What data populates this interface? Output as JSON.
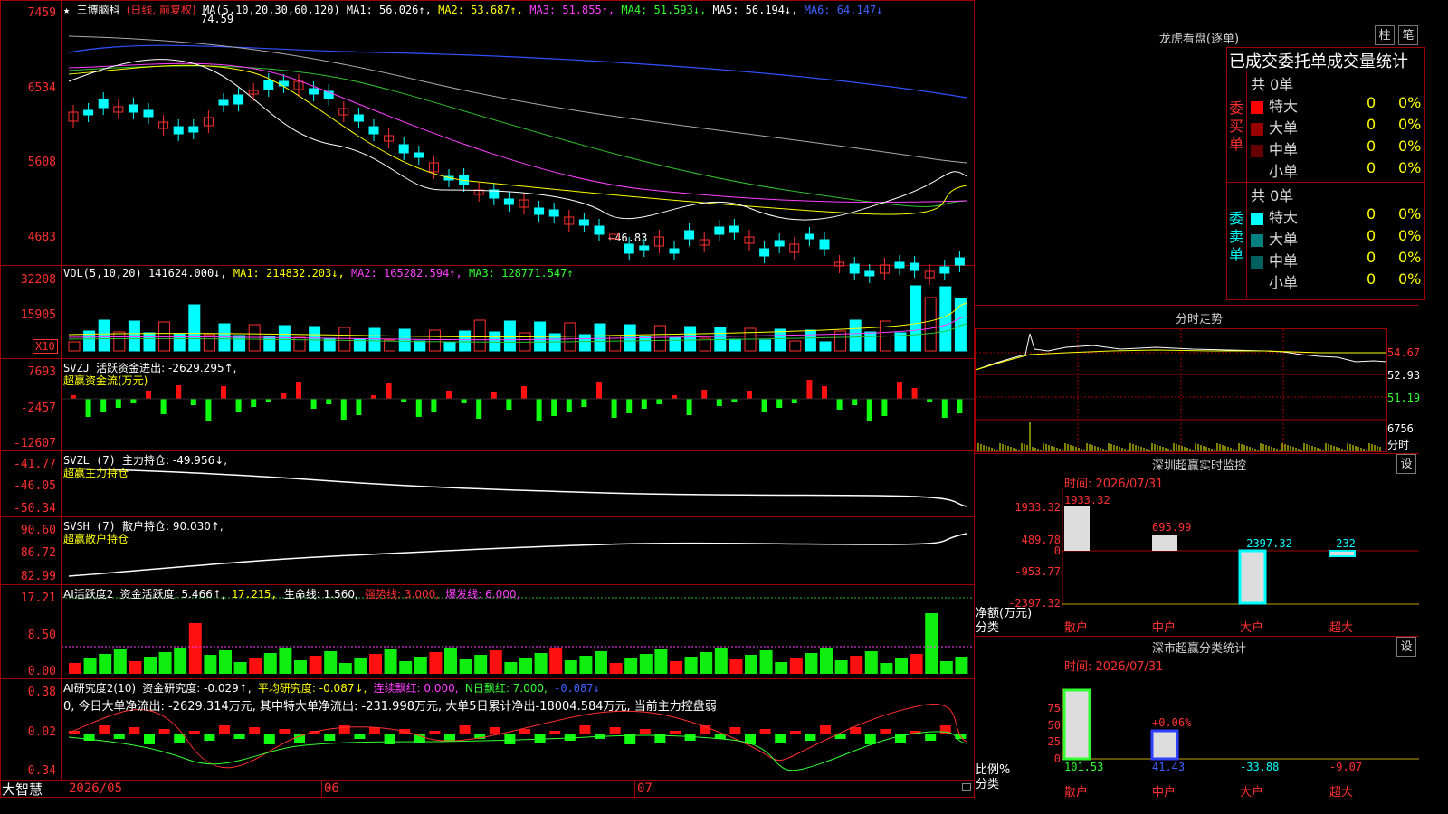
{
  "stock": {
    "name": "三博脑科",
    "period": "(日线, 前复权)",
    "star": "★"
  },
  "main": {
    "ma_label": "MA(5,10,20,30,60,120)",
    "ma1": "MA1: 56.026↑,",
    "ma2": "MA2: 53.687↑,",
    "ma3": "MA3: 51.855↑,",
    "ma4": "MA4: 51.593↓,",
    "ma5": "MA5: 56.194↓,",
    "ma6": "MA6: 64.147↓",
    "y_ticks": [
      "7459",
      "6534",
      "5608",
      "4683"
    ],
    "high_note": "74.59",
    "low_note": "←46.83",
    "price_range": [
      4683,
      7459
    ]
  },
  "vol": {
    "label": "VOL(5,10,20)",
    "value": "141624.000↓,",
    "ma1": "MA1: 214832.203↓,",
    "ma2": "MA2: 165282.594↑,",
    "ma3": "MA3: 128771.547↑",
    "y_ticks": [
      "32208",
      "15905"
    ],
    "unit": "X10"
  },
  "svzj": {
    "label": "SVZJ",
    "text": "活跃资金进出: -2629.295↑,",
    "sub": "超赢资金流(万元)",
    "y_ticks": [
      "7693",
      "-2457",
      "-12607"
    ]
  },
  "svzl": {
    "label": "SVZL (7)",
    "text": "主力持仓: -49.956↓,",
    "sub": "超赢主力持仓",
    "y_ticks": [
      "-41.77",
      "-46.05",
      "-50.34"
    ]
  },
  "svsh": {
    "label": "SVSH (7)",
    "text": "散户持仓: 90.030↑,",
    "sub": "超赢散户持仓",
    "y_ticks": [
      "90.60",
      "86.72",
      "82.99"
    ]
  },
  "ai1": {
    "label": "AI活跃度2",
    "a": "资金活跃度: 5.466↑,",
    "b": "17.215,",
    "c": "生命线: 1.560,",
    "d": "强势线: 3.000,",
    "e": "爆发线: 6.000,",
    "y_ticks": [
      "17.21",
      "8.50",
      "0.00"
    ]
  },
  "ai2": {
    "label": "AI研究度2(10)",
    "a": "资金研究度: -0.029↑,",
    "b": "平均研究度: -0.087↓,",
    "c": "连续飘红: 0.000,",
    "d": "N日飘红: 7.000,",
    "e": "-0.087↓",
    "note": "0, 今日大单净流出: -2629.314万元, 其中特大单净流出: -231.998万元, 大单5日累计净出-18004.584万元, 当前主力控盘弱",
    "y_ticks": [
      "0.38",
      "0.02",
      "-0.34"
    ]
  },
  "bottom": {
    "brand": "大智慧",
    "dates": [
      "2026/05",
      "06",
      "07"
    ]
  },
  "right": {
    "lhb_title": "龙虎看盘(逐单)",
    "btn_zhu": "柱",
    "btn_bi": "笔",
    "stat_title": "已成交委托单成交量统计",
    "buy": {
      "side": "委买单",
      "total": "共 0单",
      "rows": [
        {
          "label": "特大",
          "n": "0",
          "p": "0%",
          "color": "#ff0000"
        },
        {
          "label": "大单",
          "n": "0",
          "p": "0%",
          "color": "#990000"
        },
        {
          "label": "中单",
          "n": "0",
          "p": "0%",
          "color": "#660000"
        },
        {
          "label": "小单",
          "n": "0",
          "p": "0%",
          "color": "#000000"
        }
      ]
    },
    "sell": {
      "side": "委卖单",
      "total": "共 0单",
      "rows": [
        {
          "label": "特大",
          "n": "0",
          "p": "0%",
          "color": "#00ffff"
        },
        {
          "label": "大单",
          "n": "0",
          "p": "0%",
          "color": "#008080"
        },
        {
          "label": "中单",
          "n": "0",
          "p": "0%",
          "color": "#006060"
        },
        {
          "label": "小单",
          "n": "0",
          "p": "0%",
          "color": "#000000"
        }
      ]
    },
    "fs_title": "分时走势",
    "fs_prices": [
      "54.67",
      "52.93",
      "51.19"
    ],
    "fs_vol": "6756",
    "fs_vol_unit": "分时",
    "sz_title": "深圳超赢实时监控",
    "sz_time": "时间: 2026/07/31",
    "btn_set": "设",
    "sz_y": [
      "1933.32",
      "489.78",
      "0",
      "-953.77",
      "-2397.32"
    ],
    "sz_net_label": "净额(万元)",
    "sz_cat_label": "分类",
    "sz_values": [
      "1933.32",
      "695.99",
      "-2397.32",
      "-232"
    ],
    "cats": [
      "散户",
      "中户",
      "大户",
      "超大"
    ],
    "cls_title": "深市超赢分类统计",
    "cls_time": "时间: 2026/07/31",
    "cls_y": [
      "75",
      "50",
      "25",
      "0"
    ],
    "cls_pct_label": "比例%",
    "cls_cat_label": "分类",
    "cls_mid": "+0.06%",
    "cls_values": [
      "101.53",
      "41.43",
      "-33.88",
      "-9.07"
    ]
  }
}
